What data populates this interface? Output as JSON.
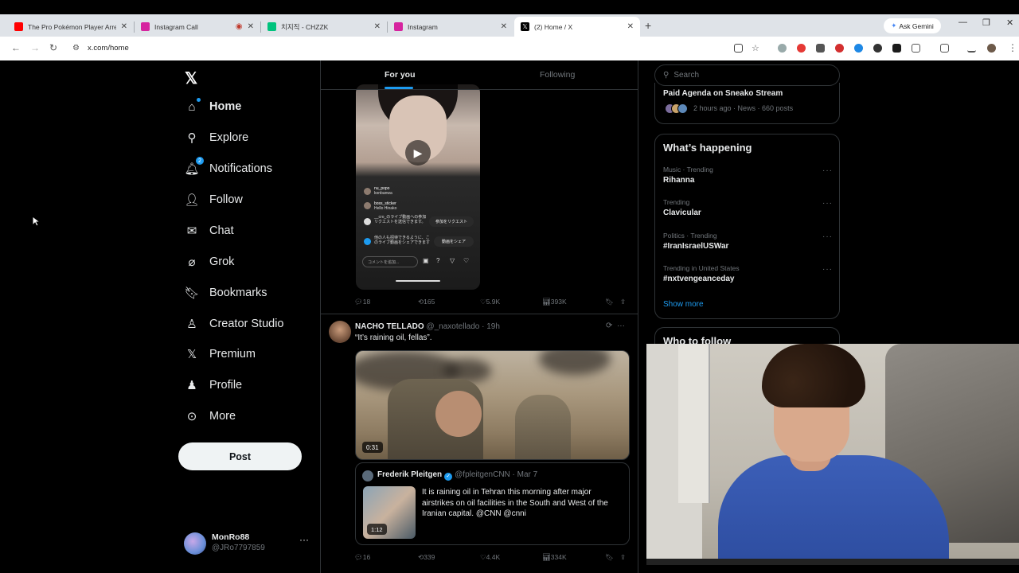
{
  "browser": {
    "tabs": [
      {
        "title": "The Pro Pokémon Player Arrest",
        "favicon_color": "#ff0000"
      },
      {
        "title": "Instagram Call",
        "favicon_color": "#d6249f"
      },
      {
        "title": "치지직 - CHZZK",
        "favicon_color": "#00c37d"
      },
      {
        "title": "Instagram",
        "favicon_color": "#d6249f"
      },
      {
        "title": "(2) Home / X",
        "favicon_color": "#000000"
      }
    ],
    "gemini_label": "Ask Gemini",
    "url": "x.com/home"
  },
  "nav": {
    "items": [
      {
        "label": "Home",
        "icon": "home-icon"
      },
      {
        "label": "Explore",
        "icon": "search-icon"
      },
      {
        "label": "Notifications",
        "icon": "bell-icon",
        "badge": "2"
      },
      {
        "label": "Follow",
        "icon": "add-person-icon"
      },
      {
        "label": "Chat",
        "icon": "mail-icon"
      },
      {
        "label": "Grok",
        "icon": "grok-icon"
      },
      {
        "label": "Bookmarks",
        "icon": "bookmark-icon"
      },
      {
        "label": "Creator Studio",
        "icon": "flask-icon"
      },
      {
        "label": "Premium",
        "icon": "x-icon"
      },
      {
        "label": "Profile",
        "icon": "person-icon"
      },
      {
        "label": "More",
        "icon": "more-circle-icon"
      }
    ],
    "post_label": "Post",
    "account": {
      "name": "MonRo88",
      "handle": "@JRo7797859"
    }
  },
  "feed": {
    "tabs": {
      "for_you": "For you",
      "following": "Following"
    },
    "tweet1": {
      "comments": [
        {
          "user": "nu_popo",
          "text": "konbanwa"
        },
        {
          "user": "boss_sticker",
          "text": "Hello Hinako"
        }
      ],
      "notice1": "__cro_のライブ動画への参加リクエストを送信できます。",
      "notice1_btn": "参加をリクエスト",
      "notice2": "他の人も招待できるように、このライブ動画をシェアできます",
      "notice2_btn": "動画をシェア",
      "comment_placeholder": "コメントを追加...",
      "stats": {
        "replies": "18",
        "reposts": "165",
        "likes": "5.9K",
        "views": "393K"
      }
    },
    "tweet2": {
      "name": "NACHO TELLADO",
      "handle_time": "@_naxotellado · 19h",
      "text": "“It’s raining oil, fellas”.",
      "video_duration": "0:31",
      "quote": {
        "name": "Frederik Pleitgen",
        "handle_time": "@fpleitgenCNN · Mar 7",
        "text": "It is raining oil in Tehran this morning after major airstrikes on oil facilities in the South and West of the Iranian capital. @CNN @cnni",
        "video_duration": "1:12"
      },
      "stats": {
        "replies": "16",
        "reposts": "339",
        "likes": "4.4K",
        "views": "334K"
      }
    }
  },
  "sidebar": {
    "search_placeholder": "Search",
    "live_card": {
      "title": "Paid Agenda on Sneako Stream",
      "meta": "2 hours ago · News · 660 posts"
    },
    "happening_title": "What’s happening",
    "trends": [
      {
        "category": "Music · Trending",
        "name": "Rihanna"
      },
      {
        "category": "Trending",
        "name": "Clavicular"
      },
      {
        "category": "Politics · Trending",
        "name": "#IranIsraelUSWar"
      },
      {
        "category": "Trending in United States",
        "name": "#nxtvengeanceday"
      }
    ],
    "show_more": "Show more",
    "who_to_follow": "Who to follow"
  }
}
